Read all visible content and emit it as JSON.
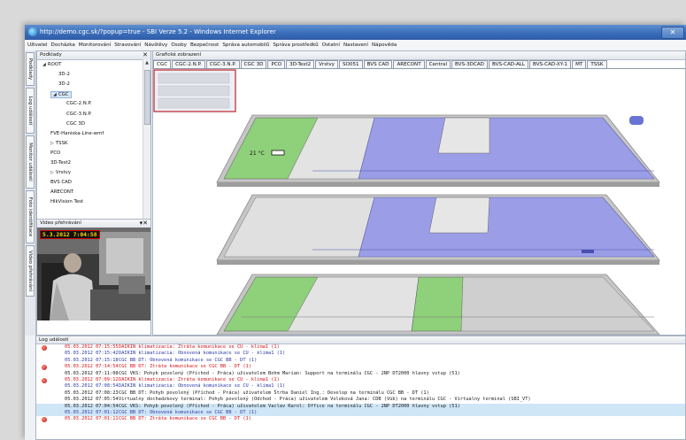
{
  "window": {
    "title": "http://demo.cgc.sk/?popup=true - SBI Verze 5.2 - Windows Internet Explorer",
    "close_glyph": "✕"
  },
  "menu": [
    "Uživatel",
    "Docházka",
    "Monitorování",
    "Stravování",
    "Návštěvy",
    "Osoby",
    "Bezpečnost",
    "Správa automobilů",
    "Správa prostředků",
    "Ostatní",
    "Nastavení",
    "Nápověda"
  ],
  "side_tabs": [
    "Podklady",
    "Log událostí",
    "Monitor událostí",
    "Foto identifikace",
    "Video přehrávání"
  ],
  "podklady": {
    "title": "Podklady",
    "close": "✕",
    "items": [
      {
        "label": "ROOT",
        "level": 0,
        "arrow": "◢"
      },
      {
        "label": "3D-2",
        "level": 2,
        "arrow": ""
      },
      {
        "label": "3D-2",
        "level": 2,
        "arrow": ""
      },
      {
        "label": "CGC",
        "level": 1,
        "arrow": "◢",
        "selected": true
      },
      {
        "label": "CGC-2.N.P.",
        "level": 3,
        "arrow": ""
      },
      {
        "label": "CGC-3.N.P.",
        "level": 3,
        "arrow": ""
      },
      {
        "label": "CGC 3D",
        "level": 3,
        "arrow": ""
      },
      {
        "label": "FVE-Haniska-Line-wmf",
        "level": 1,
        "arrow": ""
      },
      {
        "label": "TSSK",
        "level": 1,
        "arrow": "▷"
      },
      {
        "label": "PCO",
        "level": 1,
        "arrow": ""
      },
      {
        "label": "3D-Test2",
        "level": 1,
        "arrow": ""
      },
      {
        "label": "Vrstvy",
        "level": 1,
        "arrow": "▷"
      },
      {
        "label": "BVS CAD",
        "level": 1,
        "arrow": ""
      },
      {
        "label": "ARECONT",
        "level": 1,
        "arrow": ""
      },
      {
        "label": "HikVision Test",
        "level": 1,
        "arrow": ""
      }
    ]
  },
  "video": {
    "title": "Video přehrávání",
    "controls": "▾✕",
    "timestamp": "5.3.2012 7:04:58"
  },
  "graficke": {
    "title": "Grafické zobrazení",
    "tabs": [
      "CGC",
      "CGC-2.N.P.",
      "CGC-3.N.P.",
      "CGC 3D",
      "PCO",
      "3D-Test2",
      "Vrstvy",
      "SO051",
      "BVS CAD",
      "ARECONT",
      "Central",
      "BVS-3DCAD",
      "BVS-CAD-ALL",
      "BVS-CAD-XY-1",
      "MT",
      "TSSK"
    ],
    "active_tab": 0,
    "temperature": "21 °C"
  },
  "log": {
    "title": "Log událostí",
    "rows": [
      {
        "dt": "05.03.2012 07:15:55",
        "text": "DAIKIN klimatizacia: Ztráta komunikace se CU - klima1 (1)",
        "type": "err"
      },
      {
        "dt": "05.03.2012 07:15:42",
        "text": "DAIKIN klimatizacia: Obnovená komunikace se CU - klima1 (1)",
        "type": "ok"
      },
      {
        "dt": "05.03.2012 07:15:18",
        "text": "CGC BB DT: Obnovená komunikace se CGC BB - DT (1)",
        "type": "ok"
      },
      {
        "dt": "05.03.2012 07:14:54",
        "text": "CGC BB DT: Ztráta komunikace se CGC BB - DT (1)",
        "type": "err"
      },
      {
        "dt": "05.03.2012 07:11:08",
        "text": "CGC VKS: Pohyb povolený (Příchod - Práca) uživatelem Bohm Marian: Support na terminálu CGC - 2NP DT2000 hlavny vstup (51)",
        "type": "info"
      },
      {
        "dt": "05.03.2012 07:09:12",
        "text": "DAIKIN klimatizacia: Ztráta komunikace se CU - klima1 (1)",
        "type": "err"
      },
      {
        "dt": "05.03.2012 07:08:54",
        "text": "DAIKIN klimatizacia: Obnovená komunikace se CU - klima1 (1)",
        "type": "ok"
      },
      {
        "dt": "05.03.2012 07:08:23",
        "text": "CGC BB DT: Pohyb povolený (Příchod - Práca) uživatelem Štrba Daniel Ing.: Develop na terminálu CGC BB - DT (1)",
        "type": "info"
      },
      {
        "dt": "05.03.2012 07:05:54",
        "text": "Virtualny dochadzkovy terminal: Pohyb povolený (Odchod - Práca) uživatelem Voleková Jana: CDB (Vúb) na terminálu CGC - Virtualny terminal (SBI_VT)",
        "type": "info"
      },
      {
        "dt": "05.03.2012 07:04:54",
        "text": "CGC VKS: Pohyb povolený (Příchod - Práca) uživatelem Vaclav Karol: Office na terminálu CGC - 2NP DT2000 hlavny vstup (51)",
        "type": "info",
        "highlight": true
      },
      {
        "dt": "05.03.2012 07:01:12",
        "text": "CGC BB DT: Obnovená komunikace se CGC BB - DT (1)",
        "type": "ok",
        "highlight": true
      },
      {
        "dt": "05.03.2012 07:01:11",
        "text": "CGC BB DT: Ztráta komunikace se CGC BB - DT (1)",
        "type": "err"
      }
    ]
  },
  "colors": {
    "room_purple": "#9b9ee6",
    "room_green": "#8fd07a",
    "wall": "#bdbdbd",
    "error": "#d6141c",
    "ok": "#2b39a8"
  }
}
